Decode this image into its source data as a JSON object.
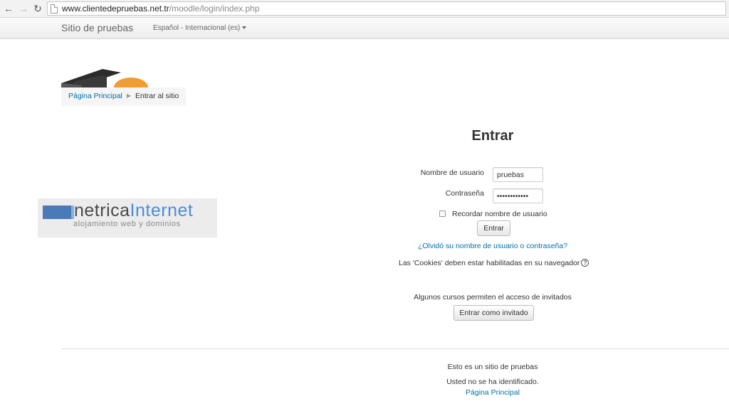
{
  "browser": {
    "back_icon": "arrow-left-icon",
    "forward_icon": "arrow-right-icon",
    "reload_icon": "reload-icon",
    "url_host": "www.clientedepruebas.net.tr",
    "url_path": "/moodle/login/index.php"
  },
  "navbar": {
    "site_name": "Sitio de pruebas",
    "language": "Español - Internacional (es)"
  },
  "breadcrumb": {
    "home": "Página Principal",
    "current": "Entrar al sitio"
  },
  "banner": {
    "word1": "netrica",
    "word2": "Internet",
    "tagline": "alojamiento web y dominios"
  },
  "login": {
    "title": "Entrar",
    "username_label": "Nombre de usuario",
    "username_value": "pruebas",
    "password_label": "Contraseña",
    "password_value": "••••••••••••",
    "remember_label": "Recordar nombre de usuario",
    "remember_checked": false,
    "submit_label": "Entrar",
    "forgot_link": "¿Olvidó su nombre de usuario o contraseña?",
    "cookies_notice": "Las 'Cookies' deben estar habilitadas en su navegador",
    "guest_notice": "Algunos cursos permiten el acceso de invitados",
    "guest_button": "Entrar como invitado"
  },
  "footer": {
    "site_notice": "Esto es un sitio de pruebas",
    "login_info": "Usted no se ha identificado.",
    "home_link": "Página Principal"
  },
  "colors": {
    "link": "#0070a8",
    "banner_blue": "#4a8ed8",
    "logo_orange": "#f39c34"
  }
}
